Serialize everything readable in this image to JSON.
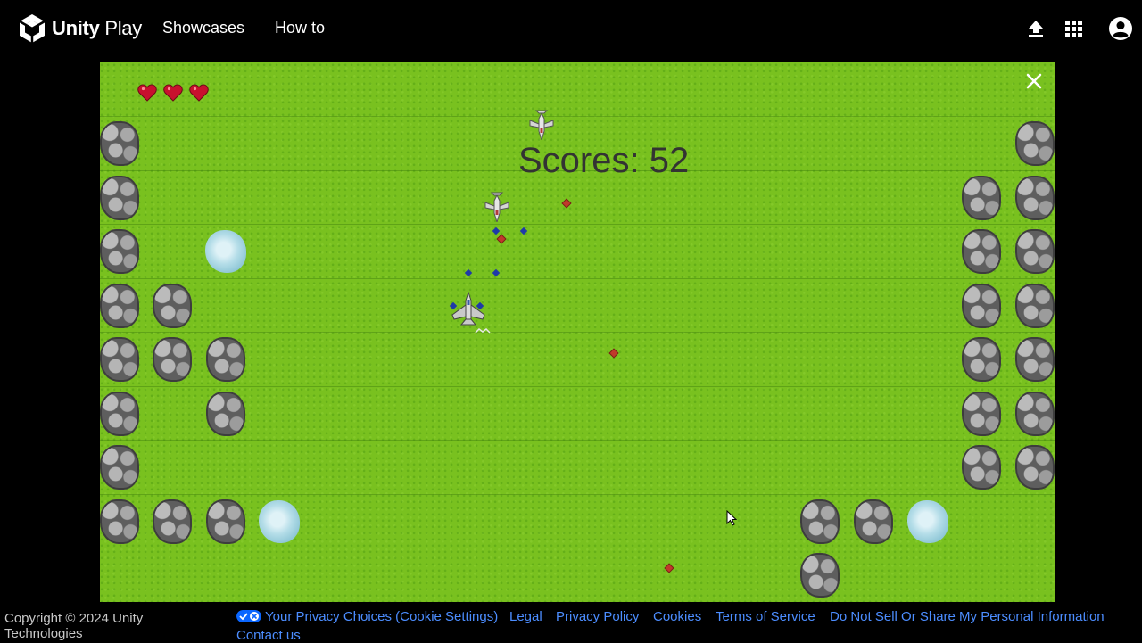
{
  "nav": {
    "logo_bold": "Unity",
    "logo_light": " Play",
    "links": [
      "Showcases",
      "How to"
    ],
    "icons": [
      "upload-icon",
      "apps-grid-icon",
      "account-icon"
    ]
  },
  "game": {
    "lives": 3,
    "score_text": "Scores: 52",
    "close_icon": "close-icon",
    "colors": {
      "grass": "#79c11f",
      "score": "#333333",
      "heart": "#c8102e"
    }
  },
  "footer": {
    "copyright": "Copyright © 2024 Unity Technologies",
    "privacy_choices": "Your Privacy Choices (Cookie Settings)",
    "legal": "Legal",
    "privacy_policy": "Privacy Policy",
    "cookies": "Cookies",
    "terms": "Terms of Service",
    "do_not_sell": "Do Not Sell Or Share My Personal Information",
    "contact": "Contact us",
    "link_color": "#4c8dff"
  }
}
